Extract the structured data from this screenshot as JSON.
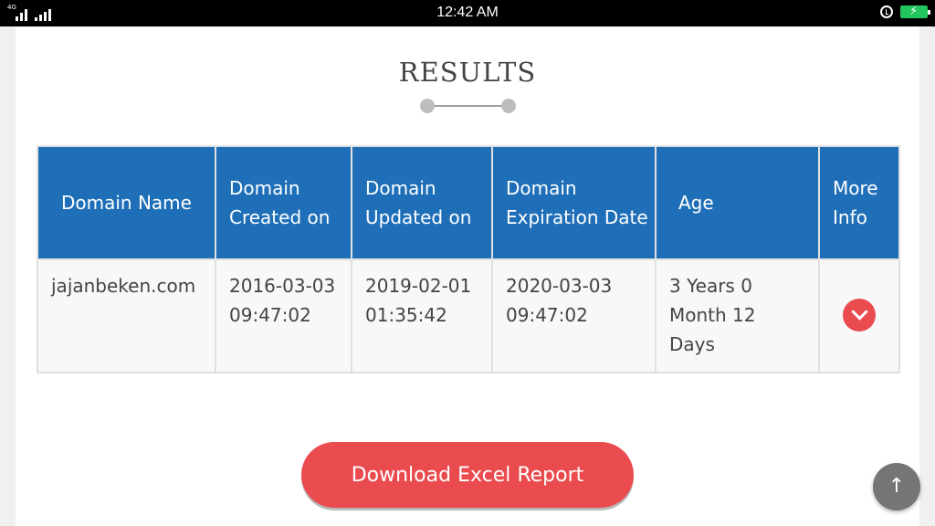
{
  "status_bar": {
    "network": "4G",
    "time": "12:42 AM"
  },
  "results": {
    "title": "RESULTS"
  },
  "table": {
    "headers": [
      "Domain Name",
      "Domain Created on",
      "Domain Updated on",
      "Domain Expiration Date",
      "Age",
      "More Info"
    ],
    "rows": [
      {
        "domain_name": "jajanbeken.com",
        "created_date": "2016-03-03",
        "created_time": "09:47:02",
        "updated_date": "2019-02-01",
        "updated_time": "01:35:42",
        "expiration_date": "2020-03-03",
        "expiration_time": "09:47:02",
        "age": "3 Years 0 Month 12 Days",
        "more_icon": "chevron-down-icon"
      }
    ]
  },
  "actions": {
    "download_label": "Download Excel Report",
    "scroll_top_icon": "↑"
  },
  "colors": {
    "header_blue": "#1f6fb8",
    "accent_red": "#ea4b4f"
  }
}
